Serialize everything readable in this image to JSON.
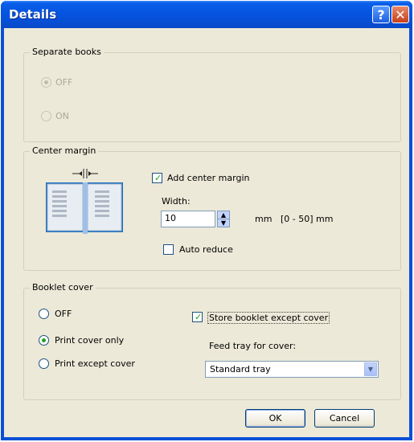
{
  "window": {
    "title": "Details",
    "help_glyph": "?",
    "close_glyph": "✕"
  },
  "separate_books": {
    "legend": "Separate books",
    "options": [
      {
        "label": "OFF",
        "selected": true,
        "enabled": false
      },
      {
        "label": "ON",
        "selected": false,
        "enabled": false
      }
    ]
  },
  "center_margin": {
    "legend": "Center margin",
    "add_center_margin": {
      "label": "Add center margin",
      "checked": true
    },
    "width": {
      "label": "Width:",
      "value": "10",
      "unit": "mm",
      "range": "[0 - 50] mm"
    },
    "auto_reduce": {
      "label": "Auto reduce",
      "checked": false
    }
  },
  "booklet_cover": {
    "legend": "Booklet cover",
    "options": [
      {
        "label": "OFF",
        "selected": false
      },
      {
        "label": "Print cover only",
        "selected": true
      },
      {
        "label": "Print except cover",
        "selected": false
      }
    ],
    "store_booklet": {
      "label": "Store booklet except cover",
      "checked": true
    },
    "feed_tray": {
      "label": "Feed tray for cover:",
      "value": "Standard tray"
    }
  },
  "buttons": {
    "ok": "OK",
    "cancel": "Cancel"
  },
  "colors": {
    "title_bar": "#0554e0",
    "dialog_bg": "#ece9d8",
    "check_green": "#21a121"
  }
}
